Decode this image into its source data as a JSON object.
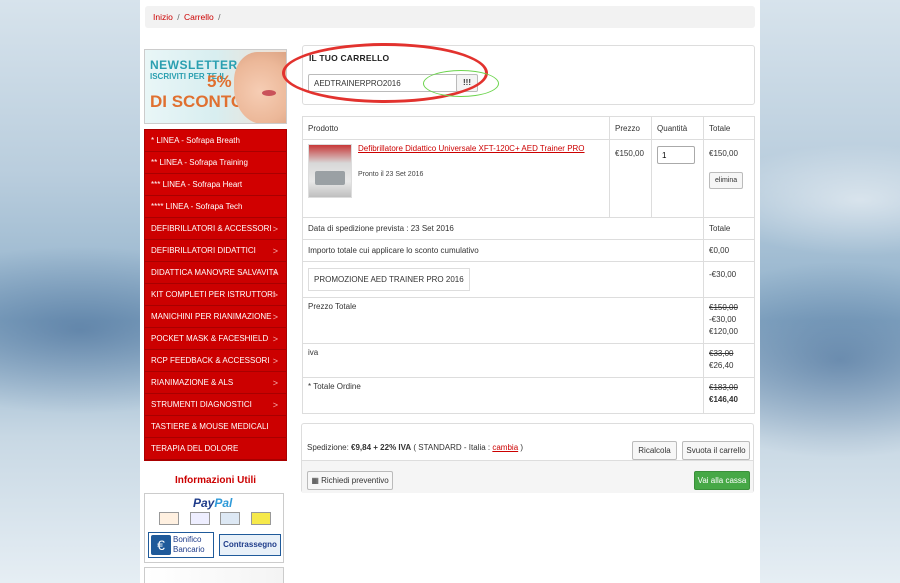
{
  "breadcrumb": {
    "home": "Inizio",
    "cart": "Carrello",
    "sep": "/"
  },
  "banner": {
    "line1": "NEWSLETTER",
    "line2": "ISCRIVITI PER TE IL",
    "pct": "5%",
    "line3": "DI SCONTO"
  },
  "menu": [
    {
      "label": "* LINEA - Sofrapa Breath",
      "arrow": false
    },
    {
      "label": "** LINEA - Sofrapa Training",
      "arrow": false
    },
    {
      "label": "*** LINEA - Sofrapa Heart",
      "arrow": false
    },
    {
      "label": "**** LINEA - Sofrapa Tech",
      "arrow": false
    },
    {
      "label": "DEFIBRILLATORI & ACCESSORI",
      "arrow": true
    },
    {
      "label": "DEFIBRILLATORI DIDATTICI",
      "arrow": true
    },
    {
      "label": "DIDATTICA MANOVRE SALVAVITA",
      "arrow": true
    },
    {
      "label": "KIT COMPLETI PER ISTRUTTORI",
      "arrow": true
    },
    {
      "label": "MANICHINI PER RIANIMAZIONE",
      "arrow": true
    },
    {
      "label": "POCKET MASK & FACESHIELD",
      "arrow": true
    },
    {
      "label": "RCP FEEDBACK & ACCESSORI",
      "arrow": true
    },
    {
      "label": "RIANIMAZIONE & ALS",
      "arrow": true
    },
    {
      "label": "STRUMENTI DIAGNOSTICI",
      "arrow": true
    },
    {
      "label": "TASTIERE & MOUSE MEDICALI",
      "arrow": false
    },
    {
      "label": "TERAPIA DEL DOLORE",
      "arrow": false
    }
  ],
  "arrow_glyph": ">",
  "info_title": "Informazioni Utili",
  "payments": {
    "paypal_a": "Pay",
    "paypal_b": "Pal",
    "cards": [
      "MasterCard",
      "VISA",
      "VISA Electron",
      "Postepay"
    ],
    "bonifico_a": "Bonifico",
    "bonifico_b": "Bancario",
    "euro": "€",
    "contrassegno": "Contrassegno"
  },
  "cart": {
    "title": "IL TUO CARRELLO",
    "voucher_value": "AEDTRAINERPRO2016",
    "voucher_button": "!!!"
  },
  "table": {
    "headers": {
      "product": "Prodotto",
      "price": "Prezzo",
      "qty": "Quantità",
      "total": "Totale"
    },
    "item": {
      "name": "Defibrillatore Didattico Universale XFT-120C+ AED Trainer PRO",
      "ready": "Pronto il 23 Set 2016",
      "price": "€150,00",
      "qty": "1",
      "total": "€150,00",
      "remove": "elimina"
    },
    "shipping_date": {
      "label": "Data di spedizione prevista : 23 Set 2016",
      "value": "Totale"
    },
    "discount_amount": {
      "label": "Importo totale cui applicare lo sconto cumulativo",
      "value": "€0,00"
    },
    "promo": {
      "label": "PROMOZIONE AED TRAINER PRO 2016",
      "value": "-€30,00"
    },
    "subtotal": {
      "label": "Prezzo Totale",
      "old": "€150,00",
      "discount": "-€30,00",
      "new": "€120,00"
    },
    "vat": {
      "label": "iva",
      "old": "€33,00",
      "new": "€26,40"
    },
    "order_total": {
      "label": "* Totale Ordine",
      "old": "€183,00",
      "new": "€146,40"
    }
  },
  "shipping": {
    "prefix": "Spedizione: ",
    "amount": "€9,84 + 22% IVA",
    "details": " ( STANDARD - Italia : ",
    "change": "cambia",
    "suffix": " )",
    "recalc": "Ricalcola",
    "empty": "Svuota il carrello",
    "quote": "Richiedi preventivo",
    "checkout": "Vai alla cassa"
  }
}
